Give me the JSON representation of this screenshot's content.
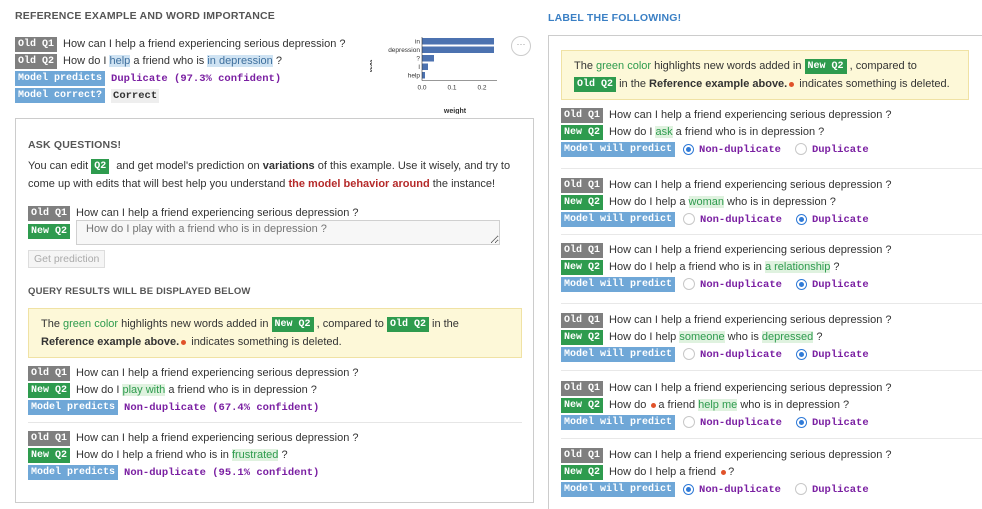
{
  "reference": {
    "title": "REFERENCE EXAMPLE AND WORD IMPORTANCE",
    "old_q1_tag": "Old Q1",
    "old_q1_text": "How can I help a friend experiencing serious depression ?",
    "old_q2_tag": "Old Q2",
    "old_q2_parts": [
      "How do I ",
      "help",
      " a friend who is ",
      "in depression",
      " ?"
    ],
    "model_predicts_tag": "Model predicts",
    "model_predicts_value": "Duplicate (97.3% confident)",
    "model_correct_tag": "Model correct?",
    "model_correct_value": "Correct",
    "menu_icon": "···"
  },
  "chart_data": {
    "type": "bar",
    "orientation": "horizontal",
    "categories": [
      "in",
      "depression",
      "?",
      "I",
      "help"
    ],
    "values": [
      0.24,
      0.24,
      0.04,
      0.02,
      0.01
    ],
    "xlabel": "weight",
    "ylabel": "text",
    "xticks": [
      "0.0",
      "0.1",
      "0.2"
    ],
    "xlim": [
      0,
      0.25
    ],
    "bar_color": "#4c72b0"
  },
  "ask": {
    "title": "ASK QUESTIONS!",
    "desc_1": "You can edit ",
    "q2_tag": "Q2",
    "desc_2": " and get model's prediction on ",
    "desc_bold": "variations",
    "desc_3": " of this example. Use it wisely, and try to come up with edits that will best help you understand ",
    "desc_red": "the model behavior around",
    "desc_4": " the instance!",
    "old_q1_tag": "Old Q1",
    "old_q1_text": "How can I help a friend experiencing serious depression ?",
    "new_q2_tag": "New Q2",
    "new_q2_placeholder": "How do I play with a friend who is in depression ?",
    "get_prediction": "Get prediction",
    "query_title": "QUERY RESULTS WILL BE DISPLAYED BELOW"
  },
  "notice": {
    "t1": "The ",
    "green_word": "green color",
    "t2": " highlights new words added in ",
    "new_q2_tag": "New Q2",
    "t3": " , compared to ",
    "old_q2_tag": "Old Q2",
    "t4": " in the ",
    "bold": "Reference example above.",
    "t5": " indicates something is deleted."
  },
  "results": [
    {
      "old_tag": "Old Q1",
      "old_text": "How can I help a friend experiencing serious depression ?",
      "new_tag": "New Q2",
      "new_parts": [
        "How do I ",
        "play with",
        " a friend who is in depression ?"
      ],
      "pred_tag": "Model predicts",
      "pred_value": "Non-duplicate (67.4% confident)"
    },
    {
      "old_tag": "Old Q1",
      "old_text": "How can I help a friend experiencing serious depression ?",
      "new_tag": "New Q2",
      "new_parts": [
        "How do I help a friend who is in ",
        "frustrated",
        " ?"
      ],
      "pred_tag": "Model predicts",
      "pred_value": "Non-duplicate (95.1% confident)"
    }
  ],
  "label": {
    "title": "LABEL THE FOLLOWING!",
    "will_predict_tag": "Model will predict",
    "non_dup": "Non-duplicate",
    "dup": "Duplicate",
    "items": [
      {
        "old_tag": "Old Q1",
        "old_text": "How can I help a friend experiencing serious depression ?",
        "new_tag": "New Q2",
        "p1": "How do I ",
        "h1": "ask",
        "p2": " a friend who is in depression ?",
        "h2": "",
        "p3": "",
        "selected": "non"
      },
      {
        "old_tag": "Old Q1",
        "old_text": "How can I help a friend experiencing serious depression ?",
        "new_tag": "New Q2",
        "p1": "How do I help a ",
        "h1": "woman",
        "p2": " who is in depression ?",
        "h2": "",
        "p3": "",
        "selected": "dup"
      },
      {
        "old_tag": "Old Q1",
        "old_text": "How can I help a friend experiencing serious depression ?",
        "new_tag": "New Q2",
        "p1": "How do I help a friend who is in ",
        "h1": "a relationship",
        "p2": " ?",
        "h2": "",
        "p3": "",
        "selected": "dup"
      },
      {
        "old_tag": "Old Q1",
        "old_text": "How can I help a friend experiencing serious depression ?",
        "new_tag": "New Q2",
        "p1": "How do I help ",
        "h1": "someone",
        "p2": " who is ",
        "h2": "depressed",
        "p3": " ?",
        "selected": "dup"
      },
      {
        "old_tag": "Old Q1",
        "old_text": "How can I help a friend experiencing serious depression ?",
        "new_tag": "New Q2",
        "p1": "How do ",
        "h1": "",
        "p2": "a friend ",
        "h2": "help me",
        "p3": " who is in depression ?",
        "selected": "dup",
        "deleted_before_p2": true
      },
      {
        "old_tag": "Old Q1",
        "old_text": "How can I help a friend experiencing serious depression ?",
        "new_tag": "New Q2",
        "p1": "How do I help a friend ",
        "h1": "",
        "p2": "?",
        "h2": "",
        "p3": "",
        "selected": "non",
        "deleted_before_p2": true
      }
    ]
  }
}
